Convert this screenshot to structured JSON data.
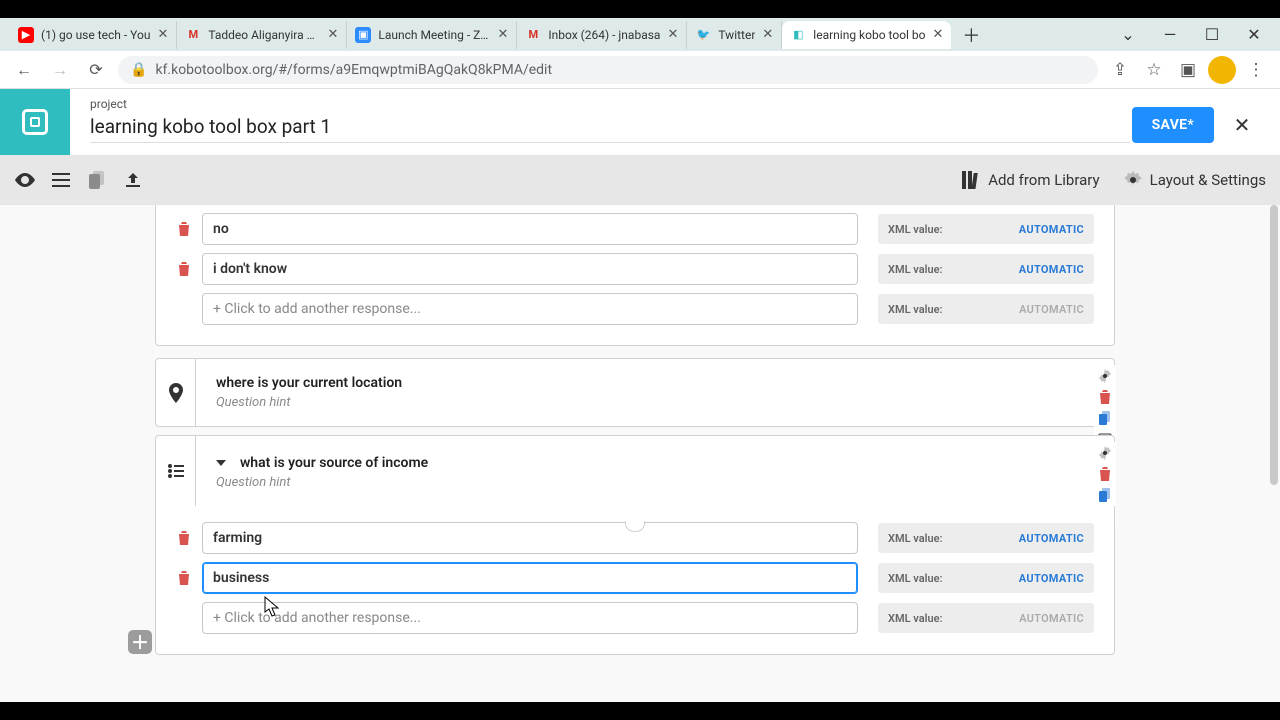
{
  "tabs": [
    {
      "title": "(1) go use tech - You",
      "fav_bg": "#f00",
      "fav_txt": "▶"
    },
    {
      "title": "Taddeo Aliganyira has",
      "fav_bg": "#fff",
      "fav_txt": "M"
    },
    {
      "title": "Launch Meeting - Zoo",
      "fav_bg": "#2d8cff",
      "fav_txt": "▣"
    },
    {
      "title": "Inbox (264) - jnabasa",
      "fav_bg": "#fff",
      "fav_txt": "M"
    },
    {
      "title": "Twitter",
      "fav_bg": "#fff",
      "fav_txt": "🐦"
    },
    {
      "title": "learning kobo tool bo",
      "fav_bg": "#fff",
      "fav_txt": "◧",
      "active": true
    }
  ],
  "url": "kf.kobotoolbox.org/#/forms/a9EmqwptmiBAgQakQ8kPMA/edit",
  "header": {
    "label": "project",
    "name": "learning kobo tool box part 1",
    "save": "SAVE*"
  },
  "toolbar": {
    "library": "Add from Library",
    "layout": "Layout & Settings"
  },
  "top_responses": [
    {
      "label": "no",
      "auto": "AUTOMATIC"
    },
    {
      "label": "i don't know",
      "auto": "AUTOMATIC"
    }
  ],
  "add_response_placeholder": "+ Click to add another response...",
  "xml_key": "XML value:",
  "xml_auto": "AUTOMATIC",
  "q_location": {
    "title": "where is your current location",
    "hint": "Question hint"
  },
  "q_income": {
    "title": "what is your source of income",
    "hint": "Question hint"
  },
  "income_responses": [
    {
      "label": "farming",
      "auto": "AUTOMATIC"
    },
    {
      "label": "business",
      "auto": "AUTOMATIC",
      "active": true
    }
  ]
}
